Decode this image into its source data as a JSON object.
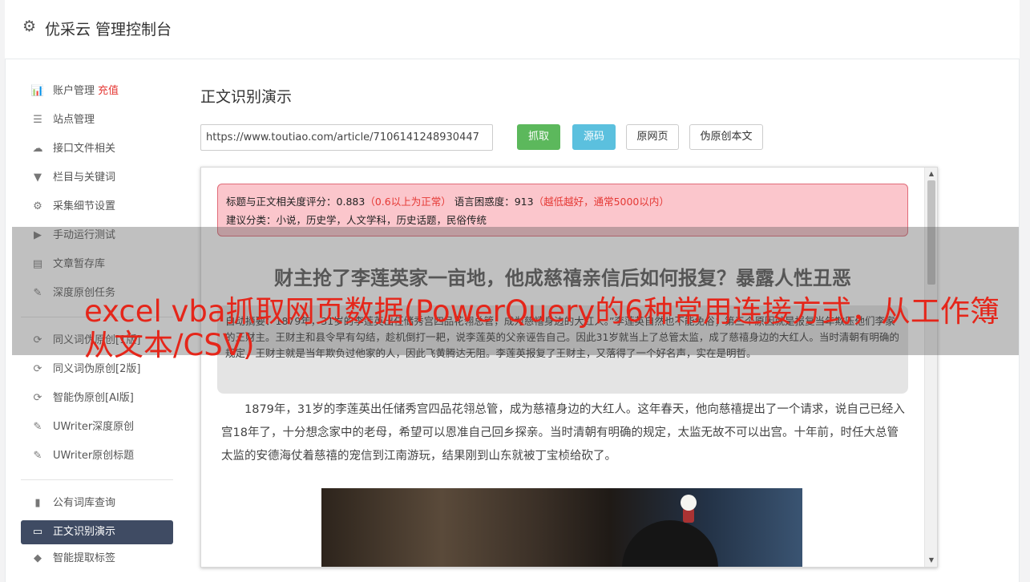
{
  "header": {
    "gear_icon": "gear-icon",
    "title": "优采云 管理控制台"
  },
  "sidebar": {
    "group1": [
      {
        "icon": "bar-chart-icon",
        "label": "账户管理",
        "tag": "充值"
      },
      {
        "icon": "server-icon",
        "label": "站点管理"
      },
      {
        "icon": "cloud-upload-icon",
        "label": "接口文件相关"
      },
      {
        "icon": "filter-icon",
        "label": "栏目与关键词"
      },
      {
        "icon": "cogs-icon",
        "label": "采集细节设置"
      },
      {
        "icon": "play-circle-icon",
        "label": "手动运行测试"
      },
      {
        "icon": "database-icon",
        "label": "文章暂存库"
      },
      {
        "icon": "edit-icon",
        "label": "深度原创任务"
      }
    ],
    "group2": [
      {
        "icon": "refresh-icon",
        "label": "同义词伪原创[1版]"
      },
      {
        "icon": "refresh-icon",
        "label": "同义词伪原创[2版]"
      },
      {
        "icon": "refresh-icon",
        "label": "智能伪原创[AI版]"
      },
      {
        "icon": "edit-icon",
        "label": "UWriter深度原创"
      },
      {
        "icon": "edit-icon",
        "label": "UWriter原创标题"
      }
    ],
    "group3": [
      {
        "icon": "book-icon",
        "label": "公有词库查询"
      },
      {
        "icon": "monitor-icon",
        "label": "正文识别演示"
      },
      {
        "icon": "tag-icon",
        "label": "智能提取标签"
      }
    ]
  },
  "main": {
    "title": "正文识别演示",
    "url_value": "https://www.toutiao.com/article/7106141248930447",
    "buttons": {
      "grab": "抓取",
      "source": "源码",
      "original": "原网页",
      "fake_original": "伪原创本文"
    }
  },
  "analysis": {
    "relevance_label": "标题与正文相关度评分：",
    "relevance_value": "0.883",
    "relevance_hint": "（0.6以上为正常）",
    "perplexity_label": "语言困惑度：",
    "perplexity_value": "913",
    "perplexity_hint": "（越低越好，通常5000以内）",
    "category_label": "建议分类：",
    "category_value": "小说，历史学，人文学科，历史话题，民俗传统"
  },
  "article": {
    "title": "财主抢了李莲英家一亩地，他成慈禧亲信后如何报复？暴露人性丑恶",
    "summary": "自动摘要：1879年，31岁的李莲英出任储秀宫四品花翎总管，成为慈禧身边的大红人。”李莲英自然也不能免俗；第三个原因就是报复当年欺压他们李家的王财主。王财主和县令早有勾结，趁机倒打一耙，说李莲英的父亲诬告自己。因此31岁就当上了总管太监，成了慈禧身边的大红人。当时清朝有明确的规定，王财主就是当年欺负过他家的人，因此飞黄腾达无阻。李莲英报复了王财主，又落得了一个好名声，实在是明哲。",
    "paragraph": "1879年，31岁的李莲英出任储秀宫四品花翎总管，成为慈禧身边的大红人。这年春天，他向慈禧提出了一个请求，说自己已经入宫18年了，十分想念家中的老母，希望可以恩准自己回乡探亲。当时清朝有明确的规定，太监无故不可以出宫。十年前，时任大总管太监的安德海仗着慈禧的宠信到江南游玩，结果刚到山东就被丁宝桢给砍了。"
  },
  "overlay": {
    "text": "excel vba抓取网页数据(PowerQuery的6种常用连接方式，从工作簿从文本/CSV)"
  }
}
